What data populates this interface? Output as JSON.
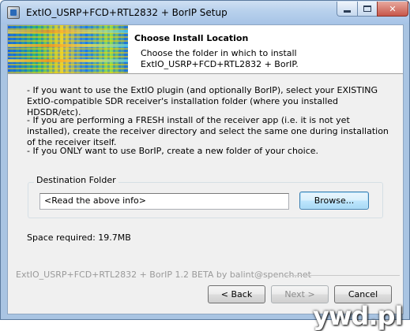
{
  "window": {
    "title": "ExtIO_USRP+FCD+RTL2832 + BorIP Setup"
  },
  "header": {
    "title": "Choose Install Location",
    "subtitle": "Choose the folder in which to install ExtIO_USRP+FCD+RTL2832 + BorIP."
  },
  "body": {
    "paragraphs": [
      "- If you want to use the ExtIO plugin (and optionally BorIP), select your EXISTING ExtIO-compatible SDR receiver's installation folder (where you installed HDSDR/etc).",
      "- If you are performing a FRESH install of the receiver app (i.e. it is not yet installed), create the receiver directory and select the same one during installation of the receiver itself.",
      "- If you ONLY want to use BorIP, create a new folder of your choice."
    ]
  },
  "destination": {
    "group_label": "Destination Folder",
    "value": "<Read the above info>",
    "browse_label": "Browse..."
  },
  "space_required": "Space required: 19.7MB",
  "footer": {
    "branding": "ExtIO_USRP+FCD+RTL2832 + BorIP 1.2 BETA by balint@spench.net",
    "back_label": "< Back",
    "next_label": "Next >",
    "cancel_label": "Cancel"
  },
  "watermark": "ywd.pl",
  "colors": {
    "titlebar": "#b7d0ec",
    "dialog_bg": "#f0f0f0",
    "close_button": "#c8574a",
    "focus_button": "#3c7fb1"
  }
}
